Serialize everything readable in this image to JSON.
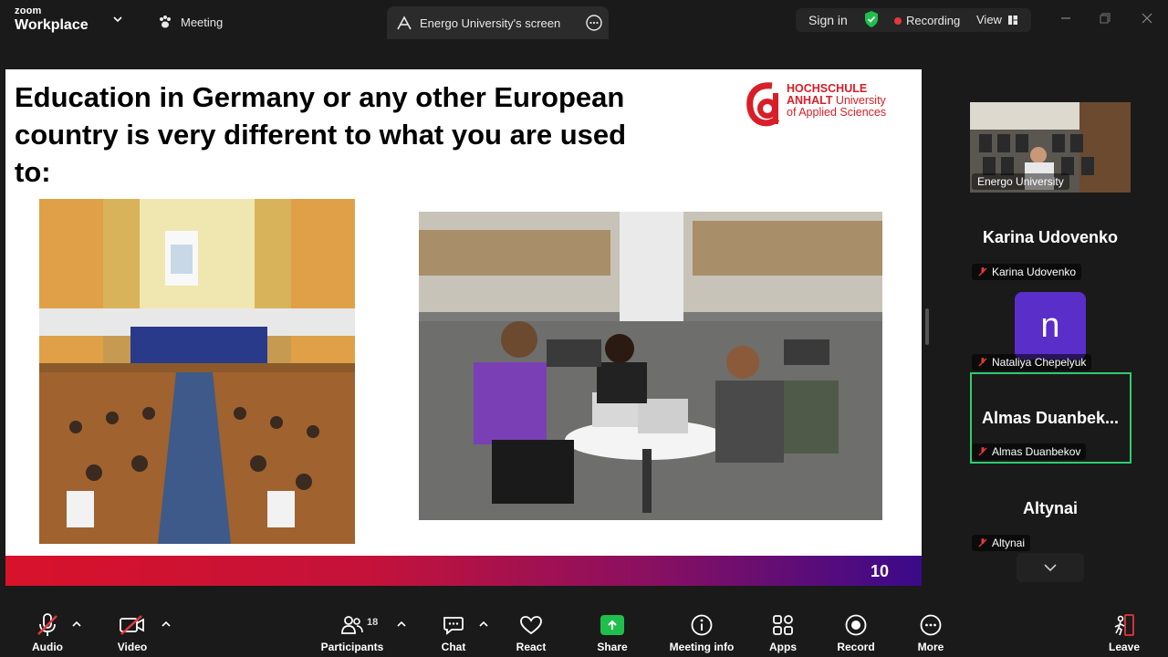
{
  "app": {
    "brand_top": "zoom",
    "brand_bottom": "Workplace"
  },
  "header": {
    "meeting_label": "Meeting",
    "screen_tab_label": "Energo University's screen",
    "sign_in": "Sign in",
    "recording": "Recording",
    "view": "View"
  },
  "slide": {
    "title": "Education in Germany or any other European country is very different to what you are used to:",
    "logo_line1": "HOCHSCHULE",
    "logo_line2_bold": "ANHALT",
    "logo_line2_rest": " University",
    "logo_line3": "of Applied Sciences",
    "page_number": "10"
  },
  "gallery": {
    "video_tile_label": "Energo University",
    "participants": [
      {
        "display_name": "Karina Udovenko",
        "label": "Karina Udovenko"
      },
      {
        "avatar_letter": "n",
        "label": "Nataliya Chepelyuk"
      },
      {
        "display_name": "Almas  Duanbek...",
        "label": "Almas Duanbekov"
      },
      {
        "display_name": "Altynai",
        "label": "Altynai"
      }
    ]
  },
  "toolbar": {
    "audio": "Audio",
    "video": "Video",
    "participants": "Participants",
    "participants_count": "18",
    "chat": "Chat",
    "react": "React",
    "share": "Share",
    "meeting_info": "Meeting info",
    "apps": "Apps",
    "record": "Record",
    "more": "More",
    "leave": "Leave"
  },
  "colors": {
    "background": "#1a1a1a",
    "recording_dot": "#e5373b",
    "shield": "#1fbf4b",
    "share_green": "#1fbf4b",
    "active_speaker": "#2ecc71",
    "avatar_purple": "#5a2ec9",
    "logo_red": "#d81e28",
    "leave_red": "#e5373b"
  }
}
